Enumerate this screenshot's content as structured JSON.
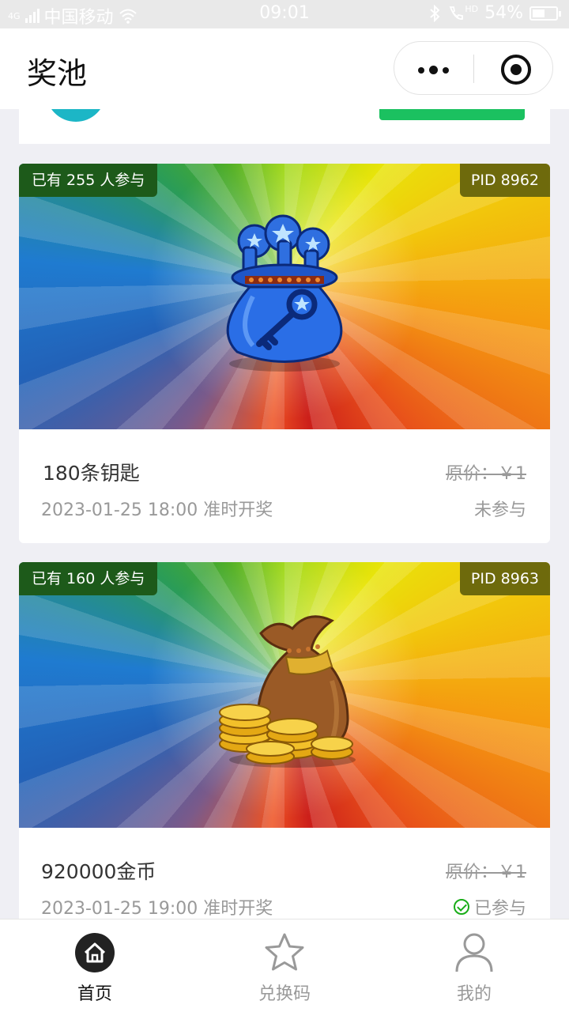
{
  "status_bar": {
    "network": "4G",
    "carrier": "中国移动",
    "time": "09:01",
    "hd": "HD",
    "battery": "54%",
    "battery_level": 0.54
  },
  "nav": {
    "title": "奖池"
  },
  "prizes": [
    {
      "participants": "已有 255 人参与",
      "pid": "PID 8962",
      "name": "180条钥匙",
      "price": "原价：￥1",
      "draw_time": "2023-01-25 18:00 准时开奖",
      "status": "未参与",
      "joined": false,
      "art_icon": "key-bag-icon"
    },
    {
      "participants": "已有 160 人参与",
      "pid": "PID 8963",
      "name": "920000金币",
      "price": "原价：￥1",
      "draw_time": "2023-01-25 19:00 准时开奖",
      "status": "已参与",
      "joined": true,
      "art_icon": "coin-bag-icon"
    }
  ],
  "tabs": [
    {
      "label": "首页",
      "icon": "home-icon",
      "active": true
    },
    {
      "label": "兑换码",
      "icon": "star-icon",
      "active": false
    },
    {
      "label": "我的",
      "icon": "user-icon",
      "active": false
    }
  ],
  "colors": {
    "accent_green": "#1bc160",
    "check_green": "#1aad19",
    "participants_badge": "#1d5a1a",
    "pid_badge": "#6e6a0c"
  }
}
